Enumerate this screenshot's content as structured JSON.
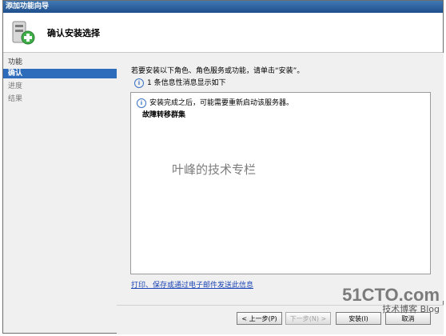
{
  "window": {
    "title": "添加功能向导"
  },
  "header": {
    "title": "确认安装选择",
    "icon": "server-add-icon"
  },
  "sidebar": {
    "items": [
      {
        "label": "功能",
        "state": "normal"
      },
      {
        "label": "确认",
        "state": "active"
      },
      {
        "label": "进度",
        "state": "disabled"
      },
      {
        "label": "结果",
        "state": "disabled"
      }
    ]
  },
  "main": {
    "instruction": "若要安装以下角色、角色服务或功能，请单击“安装”。",
    "info_count_text": "1 条信息性消息显示如下",
    "results": {
      "note": "安装完成之后，可能需要重新启动该服务器。",
      "section_title": "故障转移群集",
      "watermark": "叶峰的技术专栏"
    },
    "footer_link": "打印、保存或通过电子邮件发送此信息"
  },
  "buttons": {
    "previous": "< 上一步(P)",
    "next": "下一步(N) >",
    "install": "安装(I)",
    "cancel": "取消"
  },
  "logo": {
    "main": "51CTO.com",
    "sub": "技术博客 Blog"
  },
  "colors": {
    "accent": "#2d6cba",
    "link": "#1b44b6",
    "titlebar": "#2a5f9e"
  }
}
